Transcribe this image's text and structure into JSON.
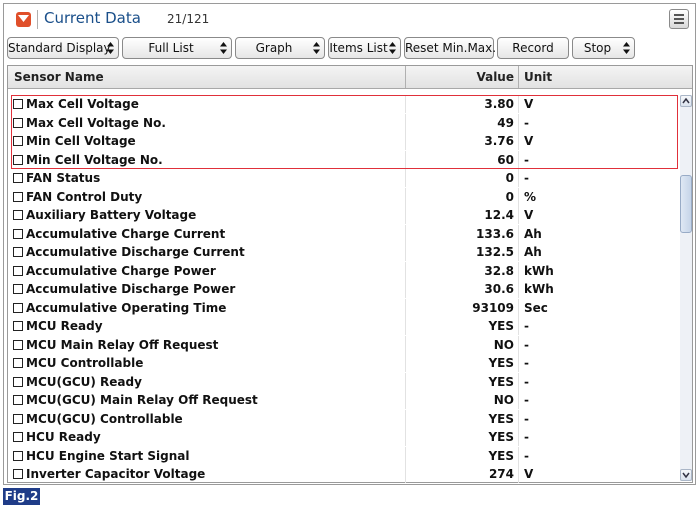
{
  "window": {
    "title": "Current Data",
    "count": "21/121"
  },
  "toolbar": {
    "buttons": [
      "Standard Display",
      "Full List",
      "Graph",
      "Items List",
      "Reset Min.Max.",
      "Record",
      "Stop"
    ]
  },
  "table": {
    "headers": {
      "name": "Sensor Name",
      "value": "Value",
      "unit": "Unit"
    },
    "rows": [
      {
        "name": "Max Cell Voltage",
        "value": "3.80",
        "unit": "V"
      },
      {
        "name": "Max Cell Voltage No.",
        "value": "49",
        "unit": "-"
      },
      {
        "name": "Min Cell Voltage",
        "value": "3.76",
        "unit": "V"
      },
      {
        "name": "Min Cell Voltage No.",
        "value": "60",
        "unit": "-"
      },
      {
        "name": "FAN Status",
        "value": "0",
        "unit": "-"
      },
      {
        "name": "FAN Control Duty",
        "value": "0",
        "unit": "%"
      },
      {
        "name": "Auxiliary Battery Voltage",
        "value": "12.4",
        "unit": "V"
      },
      {
        "name": "Accumulative Charge Current",
        "value": "133.6",
        "unit": "Ah"
      },
      {
        "name": "Accumulative Discharge Current",
        "value": "132.5",
        "unit": "Ah"
      },
      {
        "name": "Accumulative Charge Power",
        "value": "32.8",
        "unit": "kWh"
      },
      {
        "name": "Accumulative Discharge Power",
        "value": "30.6",
        "unit": "kWh"
      },
      {
        "name": "Accumulative Operating Time",
        "value": "93109",
        "unit": "Sec"
      },
      {
        "name": "MCU Ready",
        "value": "YES",
        "unit": "-"
      },
      {
        "name": "MCU Main Relay Off Request",
        "value": "NO",
        "unit": "-"
      },
      {
        "name": "MCU Controllable",
        "value": "YES",
        "unit": "-"
      },
      {
        "name": "MCU(GCU) Ready",
        "value": "YES",
        "unit": "-"
      },
      {
        "name": "MCU(GCU) Main Relay Off Request",
        "value": "NO",
        "unit": "-"
      },
      {
        "name": "MCU(GCU) Controllable",
        "value": "YES",
        "unit": "-"
      },
      {
        "name": "HCU Ready",
        "value": "YES",
        "unit": "-"
      },
      {
        "name": "HCU Engine Start Signal",
        "value": "YES",
        "unit": "-"
      },
      {
        "name": "Inverter Capacitor Voltage",
        "value": "274",
        "unit": "V"
      }
    ]
  },
  "figure_label": "Fig.2",
  "colors": {
    "title": "#1a4f8a",
    "highlight": "#e0303a",
    "fig_label_bg": "#1f3c88",
    "title_icon": "#e04f2a"
  },
  "icons": {
    "title": "chevron-down-icon",
    "menu": "menu-icon",
    "spinner": "up-down-arrows-icon"
  }
}
